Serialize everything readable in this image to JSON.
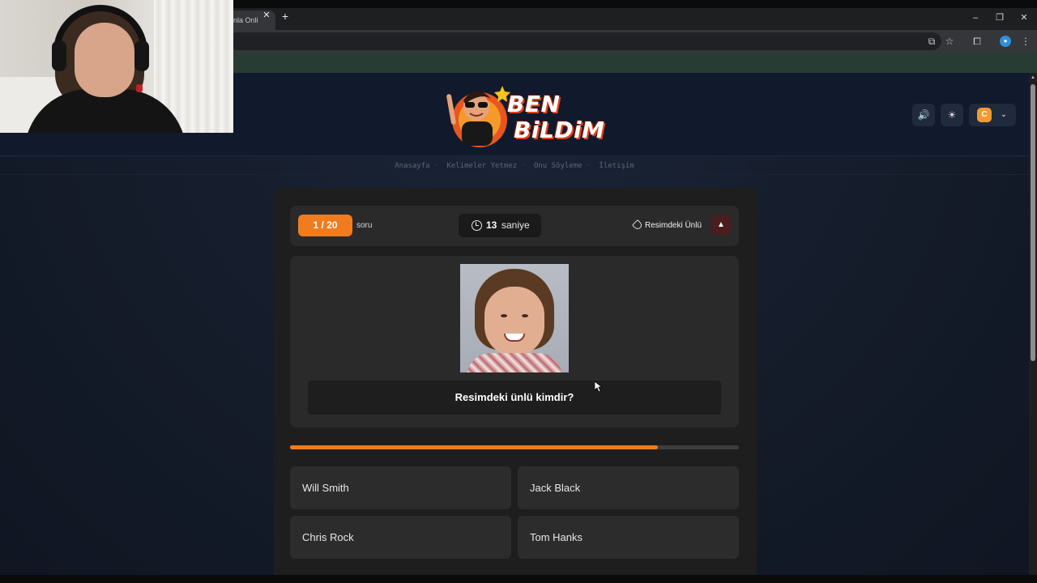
{
  "browser": {
    "tab_title": "nla Onli",
    "tab_close": "✕",
    "new_tab": "+",
    "window_controls": [
      "–",
      "❐",
      "✕"
    ],
    "toolbar_icons": [
      "install-icon",
      "star-icon",
      "extensions-icon",
      "profile-icon",
      "menu-icon"
    ]
  },
  "site": {
    "logo_line1": "BEN",
    "logo_line2": "BiLDiM",
    "accent_color": "#f07c1f"
  },
  "nav": {
    "items": [
      "Anasayfa",
      "Kelimeler Yetmez",
      "Onu Söyleme",
      "İletişim"
    ]
  },
  "header_controls": {
    "sound_icon": "🔊",
    "theme_icon": "☀",
    "user_initial": "C",
    "chevron": "⌄"
  },
  "quiz": {
    "question_counter": "1 / 20",
    "question_suffix": "soru",
    "timer_value": "13",
    "timer_unit": "saniye",
    "category": "Resimdeki Ünlü",
    "report_icon": "▲",
    "question_text": "Resimdeki ünlü kimdir?",
    "time_progress_fraction": 0.82,
    "answers": [
      "Will Smith",
      "Jack Black",
      "Chris Rock",
      "Tom Hanks"
    ]
  }
}
